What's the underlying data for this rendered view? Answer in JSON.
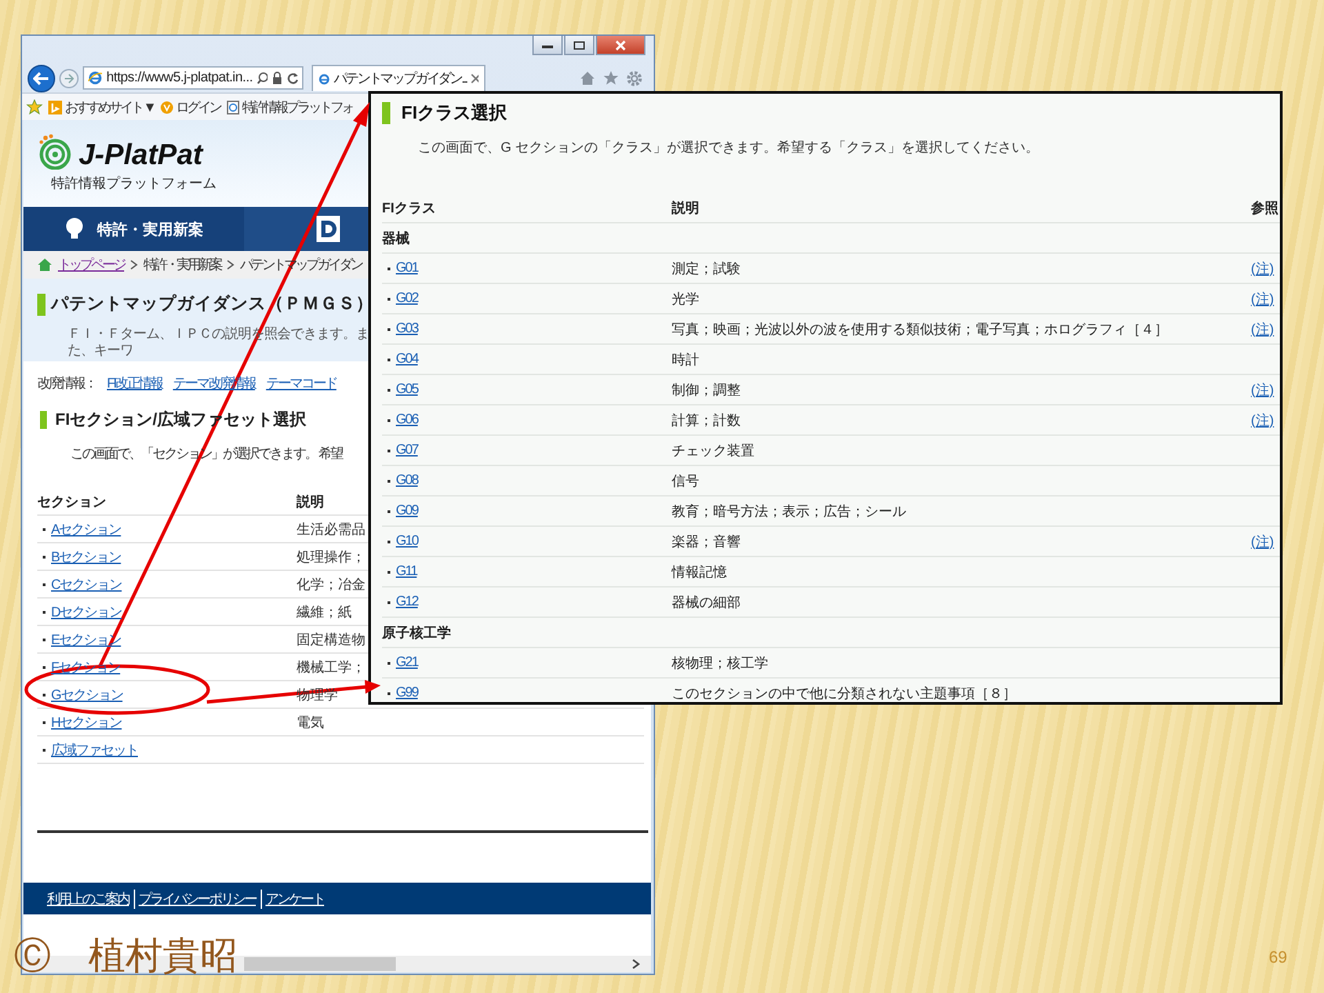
{
  "slide": {
    "copyright": "Ⓒ　植村貴昭",
    "page_number": "69"
  },
  "browser": {
    "url": "https://www5.j-platpat.in...",
    "tab_title": "パテントマップガイダン...",
    "favorites": [
      {
        "label": "おすすめサイト ▼"
      },
      {
        "label": "ログイン"
      },
      {
        "label": "特許情報プラットフォ"
      }
    ]
  },
  "site": {
    "logo": "J-PlatPat",
    "subtitle": "特許情報プラットフォーム",
    "nav": [
      {
        "label": "特許・実用新案",
        "selected": true
      }
    ],
    "breadcrumb": [
      {
        "label": "トップページ",
        "link": true
      },
      {
        "label": "特許・実用新案",
        "link": false
      },
      {
        "label": "パテントマップガイダン",
        "link": false
      }
    ],
    "page_title": "パテントマップガイダンス（ＰＭＧＳ）",
    "page_description": "ＦＩ・Ｆターム、ＩＰＣの説明を照会できます。また、キーワ",
    "revisions": {
      "label": "改廃情報：",
      "links": [
        "FI改正情報",
        "テーマ改廃情報",
        "テーマコード"
      ]
    },
    "section_heading": "FIセクション/広域ファセット選択",
    "section_description": "この画面で、「セクション」が選択できます。 希望",
    "columns": [
      "セクション",
      "説明"
    ],
    "rows": [
      {
        "name": "Aセクション",
        "description": "生活必需品"
      },
      {
        "name": "Bセクション",
        "description": "処理操作；"
      },
      {
        "name": "Cセクション",
        "description": "化学；冶金"
      },
      {
        "name": "Dセクション",
        "description": "繊維；紙"
      },
      {
        "name": "Eセクション",
        "description": "固定構造物"
      },
      {
        "name": "Fセクション",
        "description": "機械工学；"
      },
      {
        "name": "Gセクション",
        "description": "物理学"
      },
      {
        "name": "Hセクション",
        "description": "電気"
      },
      {
        "name": "広域ファセット"
      }
    ],
    "footer_links": [
      "利用上のご案内",
      "プライバシーポリシー",
      "アンケート"
    ]
  },
  "overlay": {
    "title": "FIクラス選択",
    "description": "この画面で、G セクションの「クラス」が選択できます。希望する「クラス」を選択してください。",
    "columns": [
      "FIクラス",
      "説明",
      "参照"
    ],
    "groups": [
      {
        "name": "器械",
        "classes": [
          {
            "code": "G01",
            "description": "測定；試験",
            "note": "(注)"
          },
          {
            "code": "G02",
            "description": "光学",
            "note": "(注)"
          },
          {
            "code": "G03",
            "description": "写真；映画；光波以外の波を使用する類似技術；電子写真；ホログラフィ［４］",
            "note": "(注)"
          },
          {
            "code": "G04",
            "description": "時計"
          },
          {
            "code": "G05",
            "description": "制御；調整",
            "note": "(注)"
          },
          {
            "code": "G06",
            "description": "計算；計数",
            "note": "(注)"
          },
          {
            "code": "G07",
            "description": "チェック装置"
          },
          {
            "code": "G08",
            "description": "信号"
          },
          {
            "code": "G09",
            "description": "教育；暗号方法；表示；広告；シール"
          },
          {
            "code": "G10",
            "description": "楽器；音響",
            "note": "(注)"
          },
          {
            "code": "G11",
            "description": "情報記憶"
          },
          {
            "code": "G12",
            "description": "器械の細部"
          }
        ]
      },
      {
        "name": "原子核工学",
        "classes": [
          {
            "code": "G21",
            "description": "核物理；核工学"
          },
          {
            "code": "G99",
            "description": "このセクションの中で他に分類されない主題事項［８］"
          }
        ]
      }
    ]
  }
}
